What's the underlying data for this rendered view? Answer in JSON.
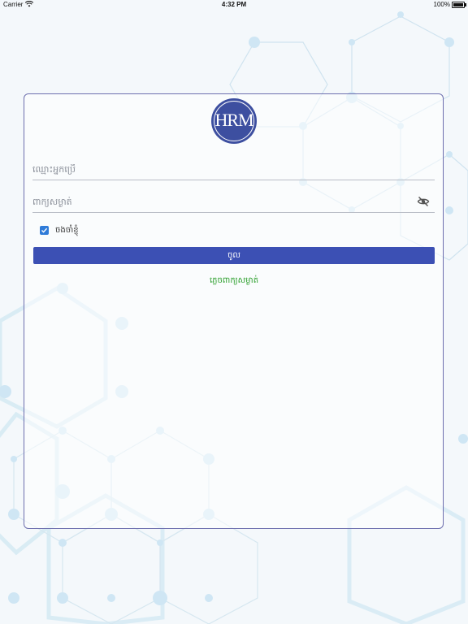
{
  "status_bar": {
    "carrier": "Carrier",
    "time": "4:32 PM",
    "battery": "100%"
  },
  "login": {
    "logo_text": "HRM",
    "username_placeholder": "ឈ្មោះអ្នកប្រើ",
    "password_placeholder": "ពាក្យសម្ងាត់",
    "remember_label": "ចងចាំខ្ញុំ",
    "remember_checked": true,
    "login_button": "ចូល",
    "forgot_link": "ភ្លេចពាក្យសម្ងាត់"
  },
  "colors": {
    "primary": "#3c50b4",
    "logo": "#3d4fa0",
    "link": "#2ea02e",
    "checkbox": "#2f7bd8"
  }
}
